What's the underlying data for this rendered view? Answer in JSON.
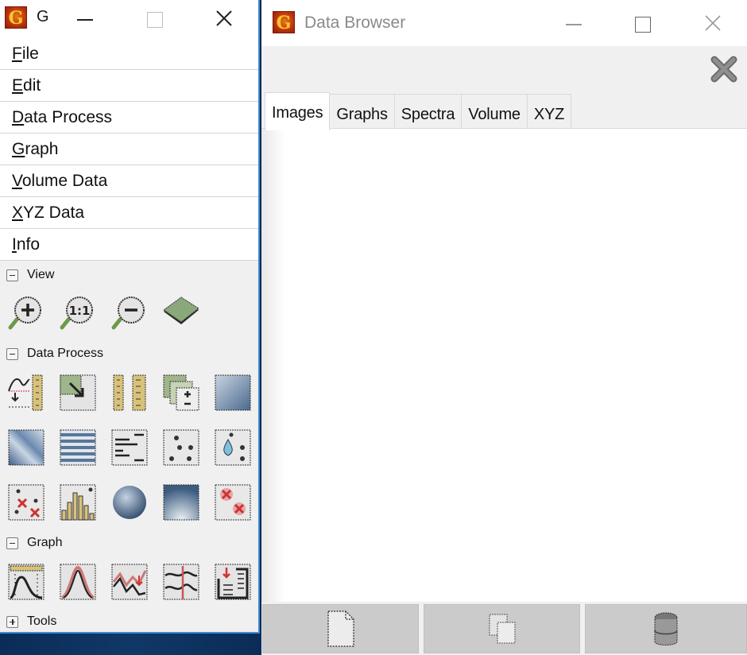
{
  "main_window": {
    "title": "G",
    "icon": "gwyddion-app-icon",
    "controls": {
      "minimize": "minimize-icon",
      "maximize": "maximize-icon",
      "close": "close-icon"
    },
    "menu": [
      {
        "label": "File",
        "mnemonic": "F",
        "rest": "ile"
      },
      {
        "label": "Edit",
        "mnemonic": "E",
        "rest": "dit"
      },
      {
        "label": "Data Process",
        "mnemonic": "D",
        "rest": "ata Process"
      },
      {
        "label": "Graph",
        "mnemonic": "G",
        "rest": "raph"
      },
      {
        "label": "Volume Data",
        "mnemonic": "V",
        "rest": "olume Data"
      },
      {
        "label": "XYZ Data",
        "mnemonic": "X",
        "rest": "YZ Data"
      },
      {
        "label": "Info",
        "mnemonic": "I",
        "rest": "nfo"
      }
    ],
    "sections": {
      "view": {
        "label": "View",
        "expanded": true,
        "tools": [
          "zoom-in-icon",
          "zoom-1-1-icon",
          "zoom-out-icon",
          "3d-view-icon"
        ]
      },
      "data_process": {
        "label": "Data Process",
        "expanded": true,
        "tools": [
          "fix-zero-icon",
          "scale-icon",
          "crop-ruler-icon",
          "arithmetic-icon",
          "gradient-icon",
          "facet-level-icon",
          "line-correct-icon",
          "align-rows-icon",
          "grains-icon",
          "watershed-icon",
          "remove-grains-icon",
          "histogram-grains-icon",
          "sphere-icon",
          "fft-icon",
          "mark-remove-icon"
        ]
      },
      "graph": {
        "label": "Graph",
        "expanded": true,
        "tools": [
          "graph-fit-icon",
          "graph-peak-icon",
          "graph-cut-icon",
          "graph-level-icon",
          "graph-export-icon"
        ]
      },
      "tools": {
        "label": "Tools",
        "expanded": false
      }
    }
  },
  "data_browser": {
    "title": "Data Browser",
    "icon": "gwyddion-app-icon",
    "toolbar": {
      "close_all": "close-all-icon"
    },
    "tabs": [
      {
        "label": "Images",
        "active": true
      },
      {
        "label": "Graphs",
        "active": false
      },
      {
        "label": "Spectra",
        "active": false
      },
      {
        "label": "Volume",
        "active": false
      },
      {
        "label": "XYZ",
        "active": false
      }
    ],
    "bottom_buttons": [
      {
        "name": "new-button",
        "icon": "new-document-icon"
      },
      {
        "name": "duplicate-button",
        "icon": "duplicate-icon"
      },
      {
        "name": "delete-button",
        "icon": "trash-icon"
      }
    ]
  }
}
